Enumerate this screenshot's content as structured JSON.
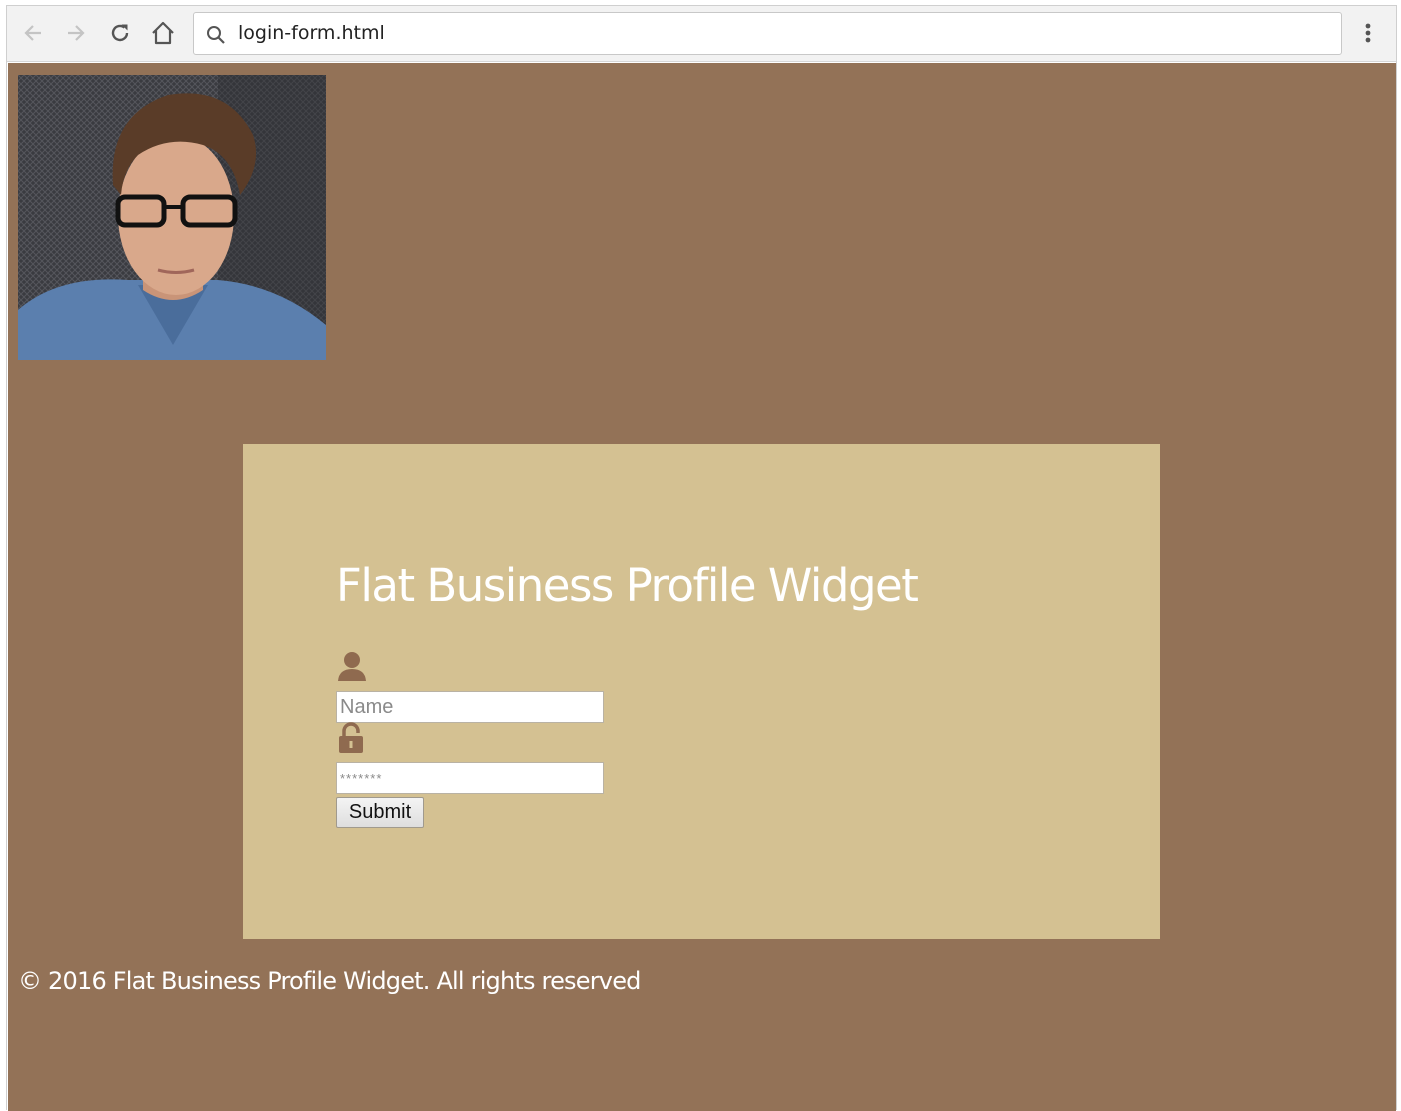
{
  "browser": {
    "address_bar": {
      "value": "login-form.html"
    },
    "icons": {
      "back": "arrow-left-icon",
      "forward": "arrow-right-icon",
      "reload": "reload-icon",
      "home": "home-icon",
      "search": "search-icon",
      "menu": "kebab-menu-icon"
    }
  },
  "page": {
    "background_color": "#937257",
    "profile_photo": {
      "description_icon": "profile-photo"
    },
    "login_panel": {
      "background_color": "#d4c192",
      "title": "Flat Business Profile Widget",
      "name_field": {
        "value": "",
        "placeholder": "Name"
      },
      "password_field": {
        "value": "",
        "placeholder": "*******"
      },
      "submit_label": "Submit",
      "icons": {
        "user": "user-icon",
        "lock": "lock-icon"
      },
      "icon_color": "#8f6a4f"
    },
    "footer": {
      "text": "© 2016 Flat Business Profile Widget. All rights reserved"
    }
  }
}
